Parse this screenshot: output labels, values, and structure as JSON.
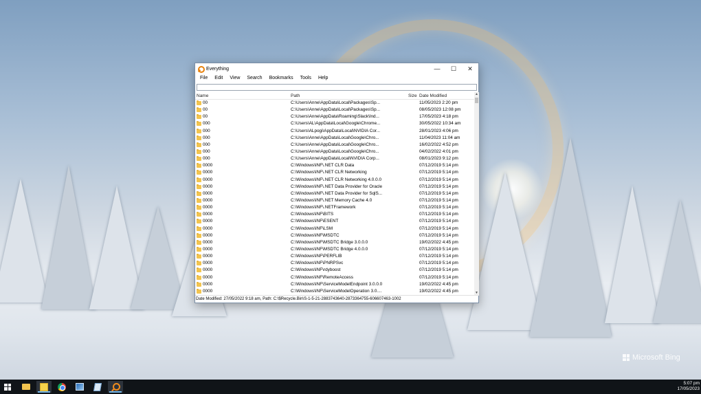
{
  "window": {
    "title": "Everything",
    "controls": {
      "minimize": "—",
      "maximize": "☐",
      "close": "✕"
    }
  },
  "menu": [
    "File",
    "Edit",
    "View",
    "Search",
    "Bookmarks",
    "Tools",
    "Help"
  ],
  "search": {
    "value": "",
    "placeholder": ""
  },
  "columns": {
    "name": "Name",
    "path": "Path",
    "size": "Size",
    "date": "Date Modified"
  },
  "rows": [
    {
      "name": "00",
      "path": "C:\\Users\\Anne\\AppData\\Local\\Packages\\Sp...",
      "date": "11/05/2023 2:20 pm"
    },
    {
      "name": "00",
      "path": "C:\\Users\\Anne\\AppData\\Local\\Packages\\Sp...",
      "date": "08/05/2023 12:08 pm"
    },
    {
      "name": "00",
      "path": "C:\\Users\\Anne\\AppData\\Roaming\\Slack\\Ind...",
      "date": "17/05/2023 4:18 pm"
    },
    {
      "name": "000",
      "path": "C:\\Users\\AL\\AppData\\Local\\Google\\Chrome...",
      "date": "30/05/2022 10:34 am"
    },
    {
      "name": "000",
      "path": "C:\\Users\\ALpogi\\AppData\\Local\\NVIDIA Cor...",
      "date": "28/01/2023 4:06 pm"
    },
    {
      "name": "000",
      "path": "C:\\Users\\Anne\\AppData\\Local\\Google\\Chro...",
      "date": "11/04/2023 11:04 am"
    },
    {
      "name": "000",
      "path": "C:\\Users\\Anne\\AppData\\Local\\Google\\Chro...",
      "date": "16/02/2022 4:52 pm"
    },
    {
      "name": "000",
      "path": "C:\\Users\\Anne\\AppData\\Local\\Google\\Chro...",
      "date": "04/02/2022 4:01 pm"
    },
    {
      "name": "000",
      "path": "C:\\Users\\Anne\\AppData\\Local\\NVIDIA Corp...",
      "date": "08/01/2023 9:12 pm"
    },
    {
      "name": "0000",
      "path": "C:\\Windows\\INF\\.NET CLR Data",
      "date": "07/12/2019 5:14 pm"
    },
    {
      "name": "0000",
      "path": "C:\\Windows\\INF\\.NET CLR Networking",
      "date": "07/12/2019 5:14 pm"
    },
    {
      "name": "0000",
      "path": "C:\\Windows\\INF\\.NET CLR Networking 4.0.0.0",
      "date": "07/12/2019 5:14 pm"
    },
    {
      "name": "0000",
      "path": "C:\\Windows\\INF\\.NET Data Provider for Oracle",
      "date": "07/12/2019 5:14 pm"
    },
    {
      "name": "0000",
      "path": "C:\\Windows\\INF\\.NET Data Provider for SqlS...",
      "date": "07/12/2019 5:14 pm"
    },
    {
      "name": "0000",
      "path": "C:\\Windows\\INF\\.NET Memory Cache 4.0",
      "date": "07/12/2019 5:14 pm"
    },
    {
      "name": "0000",
      "path": "C:\\Windows\\INF\\.NETFramework",
      "date": "07/12/2019 5:14 pm"
    },
    {
      "name": "0000",
      "path": "C:\\Windows\\INF\\BITS",
      "date": "07/12/2019 5:14 pm"
    },
    {
      "name": "0000",
      "path": "C:\\Windows\\INF\\ESENT",
      "date": "07/12/2019 5:14 pm"
    },
    {
      "name": "0000",
      "path": "C:\\Windows\\INF\\LSM",
      "date": "07/12/2019 5:14 pm"
    },
    {
      "name": "0000",
      "path": "C:\\Windows\\INF\\MSDTC",
      "date": "07/12/2019 5:14 pm"
    },
    {
      "name": "0000",
      "path": "C:\\Windows\\INF\\MSDTC Bridge 3.0.0.0",
      "date": "19/02/2022 4:45 pm"
    },
    {
      "name": "0000",
      "path": "C:\\Windows\\INF\\MSDTC Bridge 4.0.0.0",
      "date": "07/12/2019 5:14 pm"
    },
    {
      "name": "0000",
      "path": "C:\\Windows\\INF\\PERFLIB",
      "date": "07/12/2019 5:14 pm"
    },
    {
      "name": "0000",
      "path": "C:\\Windows\\INF\\PNRPSvc",
      "date": "07/12/2019 5:14 pm"
    },
    {
      "name": "0000",
      "path": "C:\\Windows\\INF\\rdyboost",
      "date": "07/12/2019 5:14 pm"
    },
    {
      "name": "0000",
      "path": "C:\\Windows\\INF\\RemoteAccess",
      "date": "07/12/2019 5:14 pm"
    },
    {
      "name": "0000",
      "path": "C:\\Windows\\INF\\ServiceModelEndpoint 3.0.0.0",
      "date": "19/02/2022 4:45 pm"
    },
    {
      "name": "0000",
      "path": "C:\\Windows\\INF\\ServiceModelOperation 3.0....",
      "date": "19/02/2022 4:45 pm"
    }
  ],
  "status": "Date Modified: 27/05/2022 9:18 am, Path: C:\\$Recycle.Bin\\S-1-5-21-2883743640-2873364755-606607463-1002",
  "watermark": "Microsoft Bing",
  "taskbar": {
    "items": [
      "windows-start-icon",
      "file-explorer-icon",
      "sticky-notes-icon",
      "chrome-icon",
      "photos-icon",
      "notepad-icon",
      "everything-icon"
    ],
    "time": "5:07 pm",
    "date": "17/05/2023"
  },
  "colors": {
    "accent": "#76b9ed",
    "folder": "#f2c44f",
    "everything": "#f28c1c"
  }
}
